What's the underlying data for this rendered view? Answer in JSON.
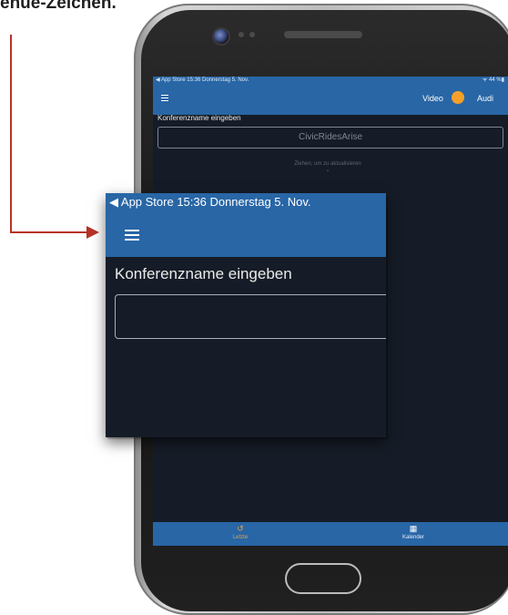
{
  "caption": "enue-Zeichen.",
  "phone_screen": {
    "status_bar": {
      "left": "◀ App Store  15:36  Donnerstag 5. Nov.",
      "right": "ᯤ 44 %▮"
    },
    "nav": {
      "video_label": "Video",
      "audio_label": "Audi"
    },
    "conference_label": "Konferenzname eingeben",
    "conference_input_value": "CivicRidesArise",
    "pull_hint": "Ziehen, um zu aktualisieren",
    "pull_chevron": "⌄",
    "tabs": [
      {
        "label": "Letzte",
        "icon": "↺",
        "icon_name": "recent-clock-icon"
      },
      {
        "label": "Kalender",
        "icon": "▦",
        "icon_name": "calendar-icon"
      }
    ]
  },
  "zoom": {
    "status_bar": "◀ App Store   15:36   Donnerstag 5. Nov.",
    "conference_label": "Konferenzname eingeben",
    "conference_input_value": ""
  },
  "colors": {
    "accent_blue": "#2866a6",
    "background": "#161c27",
    "toggle_orange": "#f6a02a",
    "arrow_red": "#b83228"
  }
}
